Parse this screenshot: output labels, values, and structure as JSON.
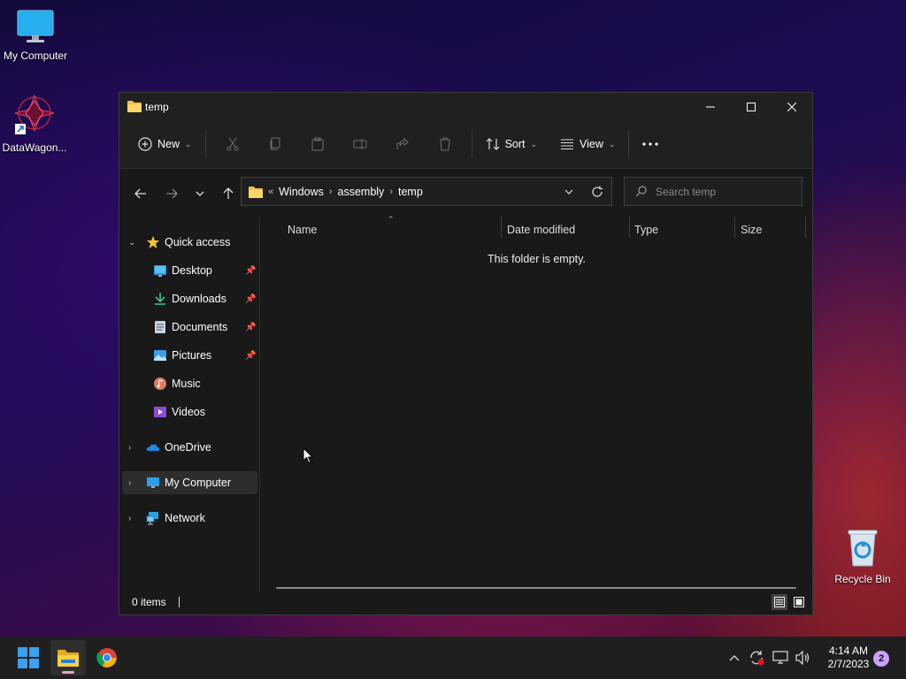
{
  "desktop": {
    "icons": [
      {
        "label": "My Computer"
      },
      {
        "label": "DataWagon..."
      },
      {
        "label": "Recycle Bin"
      }
    ]
  },
  "window": {
    "title": "temp",
    "toolbar": {
      "new_label": "New",
      "sort_label": "Sort",
      "view_label": "View"
    },
    "address": {
      "overflow": "«",
      "crumbs": [
        "Windows",
        "assembly",
        "temp"
      ]
    },
    "search": {
      "placeholder": "Search temp"
    },
    "sidebar": {
      "quick_access": "Quick access",
      "items": [
        {
          "label": "Desktop",
          "pinned": true
        },
        {
          "label": "Downloads",
          "pinned": true
        },
        {
          "label": "Documents",
          "pinned": true
        },
        {
          "label": "Pictures",
          "pinned": true
        },
        {
          "label": "Music",
          "pinned": false
        },
        {
          "label": "Videos",
          "pinned": false
        }
      ],
      "onedrive": "OneDrive",
      "my_computer": "My Computer",
      "network": "Network"
    },
    "columns": [
      "Name",
      "Date modified",
      "Type",
      "Size"
    ],
    "empty_message": "This folder is empty.",
    "status": {
      "items": "0 items"
    }
  },
  "taskbar": {
    "time": "4:14 AM",
    "date": "2/7/2023",
    "notification_count": "2"
  },
  "colors": {
    "folder": "#f4c34a",
    "accent_start": "#0078d4"
  }
}
